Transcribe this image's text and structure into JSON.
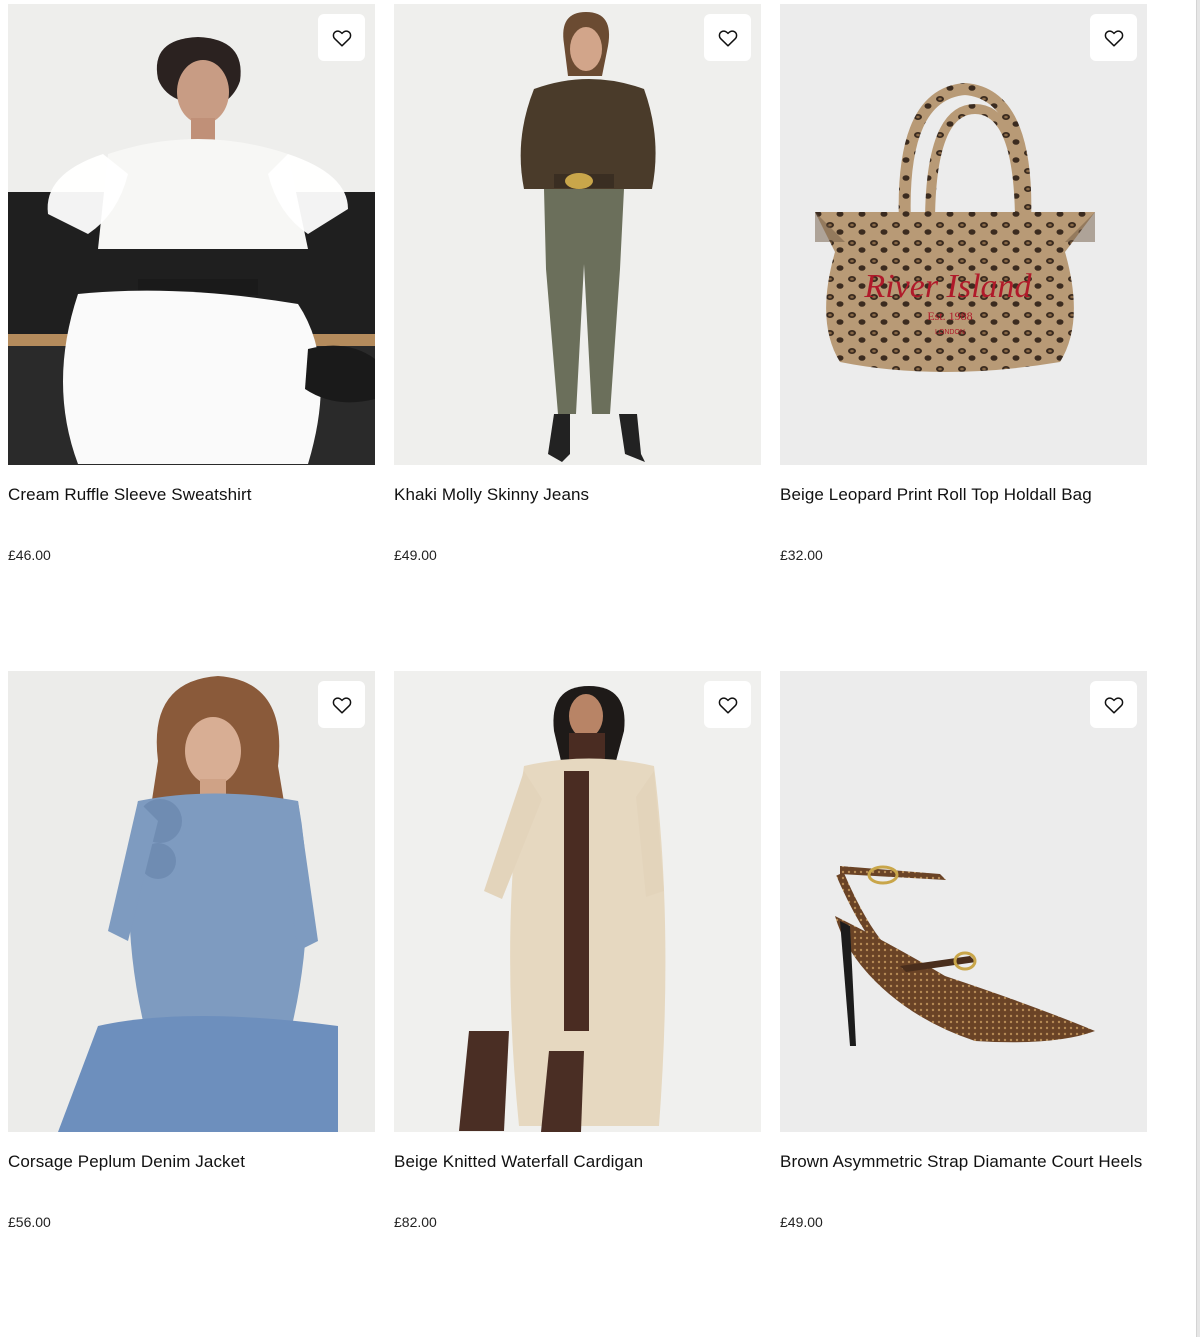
{
  "products": [
    {
      "title": "Cream Ruffle Sleeve Sweatshirt",
      "price": "£46.00",
      "wishlist_icon": "heart-outline-icon"
    },
    {
      "title": "Khaki Molly Skinny Jeans",
      "price": "£49.00",
      "wishlist_icon": "heart-outline-icon"
    },
    {
      "title": "Beige Leopard Print Roll Top Holdall Bag",
      "price": "£32.00",
      "wishlist_icon": "heart-outline-icon"
    },
    {
      "title": "Corsage Peplum Denim Jacket",
      "price": "£56.00",
      "wishlist_icon": "heart-outline-icon"
    },
    {
      "title": "Beige Knitted Waterfall Cardigan",
      "price": "£82.00",
      "wishlist_icon": "heart-outline-icon"
    },
    {
      "title": "Brown Asymmetric Strap Diamante Court Heels",
      "price": "£49.00",
      "wishlist_icon": "heart-outline-icon"
    }
  ],
  "bag_print": {
    "brand": "River Island",
    "est": "Est. 1988",
    "city": "LONDON"
  },
  "colors": {
    "page_bg": "#ffffff",
    "text": "#111111",
    "photo_bg": "#ececec",
    "bag_text": "#b01a2a"
  }
}
